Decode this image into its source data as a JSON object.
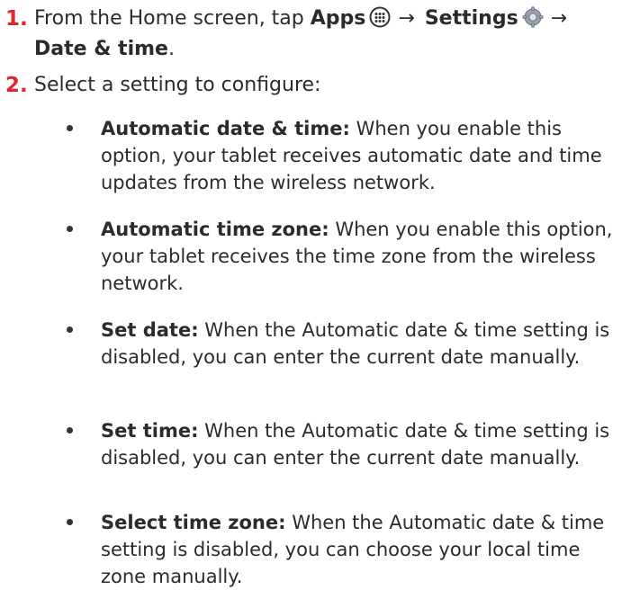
{
  "colors": {
    "step_number": "#e0262f",
    "text": "#2b2b2b"
  },
  "steps": [
    {
      "number": "1.",
      "pre": "From the Home screen, tap ",
      "apps": "Apps",
      "apps_icon": "apps-grid-icon",
      "arrow1": "→",
      "settings": "Settings",
      "settings_icon": "settings-gear-icon",
      "arrow2": "→",
      "date_time": "Date & time",
      "end": "."
    },
    {
      "number": "2.",
      "text": "Select a setting to configure:"
    }
  ],
  "bullets": [
    {
      "label": "Automatic date & time:",
      "text": " When you enable this option, your tablet receives automatic date and time updates from the wireless network."
    },
    {
      "label": "Automatic time zone:",
      "text": " When you enable this option, your tablet receives the time zone from the wireless network."
    },
    {
      "label": "Set date:",
      "text": " When the Automatic date & time setting is disabled, you can enter the current date manually."
    },
    {
      "label": "Set time:",
      "text": " When the Automatic date & time setting is disabled, you can enter the current date manually."
    },
    {
      "label": "Select time zone:",
      "text": " When the Automatic date & time setting is disabled, you can choose your local time zone manually."
    }
  ]
}
